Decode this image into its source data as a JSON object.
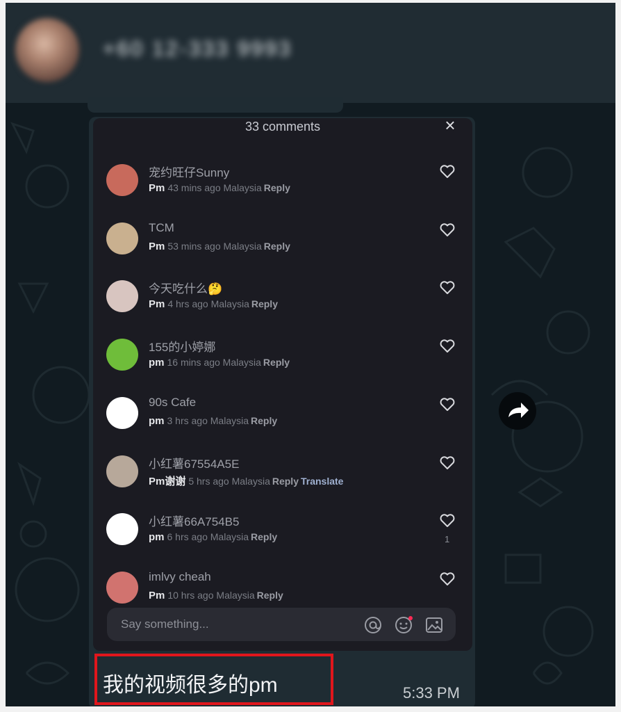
{
  "header": {
    "contact_name": "+60 12-333 9993"
  },
  "comments_panel": {
    "title": "33 comments",
    "close_label": "×",
    "comments": [
      {
        "user": "宠约旺仔Sunny",
        "text": "Pm",
        "time": "43 mins ago",
        "location": "Malaysia",
        "reply": "Reply",
        "translate": "",
        "likes": "",
        "avatar_color": "#c86a5c"
      },
      {
        "user": "TCM",
        "text": "Pm",
        "time": "53 mins ago",
        "location": "Malaysia",
        "reply": "Reply",
        "translate": "",
        "likes": "",
        "avatar_color": "#c9b08f"
      },
      {
        "user": "今天吃什么🤔",
        "text": "Pm",
        "time": "4 hrs ago",
        "location": "Malaysia",
        "reply": "Reply",
        "translate": "",
        "likes": "",
        "avatar_color": "#d8c5c0"
      },
      {
        "user": "155的小婷娜",
        "text": "pm",
        "time": "16 mins ago",
        "location": "Malaysia",
        "reply": "Reply",
        "translate": "",
        "likes": "",
        "avatar_color": "#6fbd3a"
      },
      {
        "user": "90s Cafe",
        "text": "pm",
        "time": "3 hrs ago",
        "location": "Malaysia",
        "reply": "Reply",
        "translate": "",
        "likes": "",
        "avatar_color": "#ffffff"
      },
      {
        "user": "小红薯67554A5E",
        "text": "Pm谢谢",
        "time": "5 hrs ago",
        "location": "Malaysia",
        "reply": "Reply",
        "translate": "Translate",
        "likes": "",
        "avatar_color": "#b7a89a"
      },
      {
        "user": "小红薯66A754B5",
        "text": "pm",
        "time": "6 hrs ago",
        "location": "Malaysia",
        "reply": "Reply",
        "translate": "",
        "likes": "1",
        "avatar_color": "#ffffff"
      },
      {
        "user": "imlvy cheah",
        "text": "Pm",
        "time": "10 hrs ago",
        "location": "Malaysia",
        "reply": "Reply",
        "translate": "",
        "likes": "",
        "avatar_color": "#d1736f"
      }
    ],
    "input_placeholder": "Say something..."
  },
  "message": {
    "text": "我的视频很多的pm",
    "time": "5:33 PM"
  },
  "colors": {
    "highlight": "#e0161c",
    "panel_bg": "#1b1b22",
    "bubble_bg": "#1f2c33",
    "header_bg": "#202c33"
  },
  "icons": [
    "close-icon",
    "heart-icon",
    "at-icon",
    "emoji-icon",
    "image-icon",
    "forward-icon"
  ]
}
